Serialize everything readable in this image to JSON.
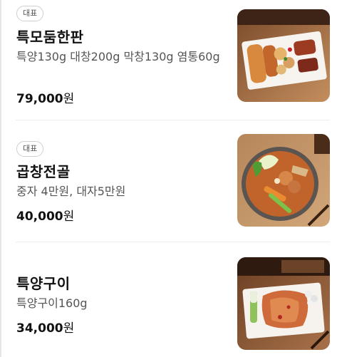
{
  "menu": {
    "items": [
      {
        "badge": "대표",
        "name": "특모둠한판",
        "description": "특양130g 대창200g 막창130g 염통60g",
        "price_amount": "79,000",
        "price_unit": "원",
        "image_icon": "grilled-platter-photo"
      },
      {
        "badge": "대표",
        "name": "곱창전골",
        "description": "중자 4만원, 대자5만원",
        "price_amount": "40,000",
        "price_unit": "원",
        "image_icon": "hotpot-photo"
      },
      {
        "badge": "",
        "name": "특양구이",
        "description": "특양구이160g",
        "price_amount": "34,000",
        "price_unit": "원",
        "image_icon": "grilled-tripe-photo"
      }
    ]
  },
  "colors": {
    "background": "#ffffff",
    "divider": "#eeeeee",
    "text_primary": "#111111",
    "text_secondary": "#555555",
    "badge_border": "#cfcfcf"
  }
}
